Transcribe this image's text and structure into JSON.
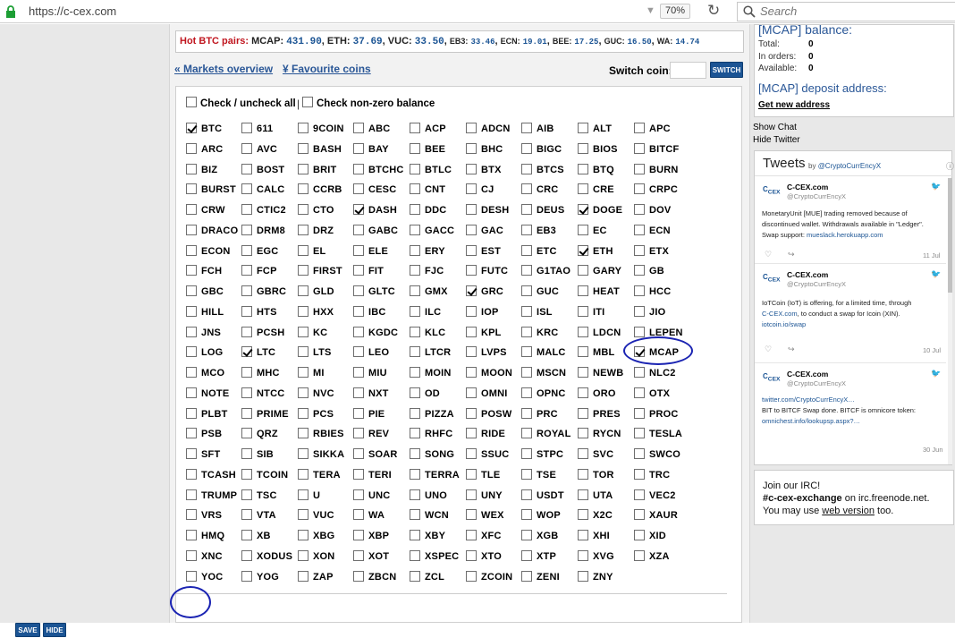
{
  "browser": {
    "url": "https://c-cex.com",
    "zoom": "70%",
    "search_placeholder": "Search"
  },
  "ticker": {
    "label": "Hot BTC pairs:",
    "items": [
      {
        "name": "MCAP",
        "value": "431.90",
        "small": false
      },
      {
        "name": "ETH",
        "value": "37.69",
        "small": false
      },
      {
        "name": "VUC",
        "value": "33.50",
        "small": false
      },
      {
        "name": "EB3",
        "value": "33.46",
        "small": true
      },
      {
        "name": "ECN",
        "value": "19.01",
        "small": true
      },
      {
        "name": "BEE",
        "value": "17.25",
        "small": true
      },
      {
        "name": "GUC",
        "value": "16.50",
        "small": true
      },
      {
        "name": "WA",
        "value": "14.74",
        "small": true
      }
    ]
  },
  "nav": {
    "markets": "Markets overview",
    "favourites": "Favourite coins",
    "switch_label": "Switch coin:",
    "switch_btn": "SWITCH"
  },
  "panel": {
    "check_all": "Check / uncheck all",
    "check_nonzero": "Check non-zero balance",
    "save": "SAVE",
    "hide": "HIDE"
  },
  "coins": [
    "BTC",
    "611",
    "9COIN",
    "ABC",
    "ACP",
    "ADCN",
    "AIB",
    "ALT",
    "APC",
    "ARC",
    "AVC",
    "BASH",
    "BAY",
    "BEE",
    "BHC",
    "BIGC",
    "BIOS",
    "BITCF",
    "BIZ",
    "BOST",
    "BRIT",
    "BTCHC",
    "BTLC",
    "BTX",
    "BTCS",
    "BTQ",
    "BURN",
    "BURST",
    "CALC",
    "CCRB",
    "CESC",
    "CNT",
    "CJ",
    "CRC",
    "CRE",
    "CRPC",
    "CRW",
    "CTIC2",
    "CTO",
    "DASH",
    "DDC",
    "DESH",
    "DEUS",
    "DOGE",
    "DOV",
    "DRACO",
    "DRM8",
    "DRZ",
    "GABC",
    "GACC",
    "GAC",
    "EB3",
    "EC",
    "ECN",
    "ECON",
    "EGC",
    "EL",
    "ELE",
    "ERY",
    "EST",
    "ETC",
    "ETH",
    "ETX",
    "FCH",
    "FCP",
    "FIRST",
    "FIT",
    "FJC",
    "FUTC",
    "G1TAO",
    "GARY",
    "GB",
    "GBC",
    "GBRC",
    "GLD",
    "GLTC",
    "GMX",
    "GRC",
    "GUC",
    "HEAT",
    "HCC",
    "HILL",
    "HTS",
    "HXX",
    "IBC",
    "ILC",
    "IOP",
    "ISL",
    "ITI",
    "JIO",
    "JNS",
    "PCSH",
    "KC",
    "KGDC",
    "KLC",
    "KPL",
    "KRC",
    "LDCN",
    "LEPEN",
    "LOG",
    "LTC",
    "LTS",
    "LEO",
    "LTCR",
    "LVPS",
    "MALC",
    "MBL",
    "MCAP",
    "MCO",
    "MHC",
    "MI",
    "MIU",
    "MOIN",
    "MOON",
    "MSCN",
    "NEWB",
    "NLC2",
    "NOTE",
    "NTCC",
    "NVC",
    "NXT",
    "OD",
    "OMNI",
    "OPNC",
    "ORO",
    "OTX",
    "PLBT",
    "PRIME",
    "PCS",
    "PIE",
    "PIZZA",
    "POSW",
    "PRC",
    "PRES",
    "PROC",
    "PSB",
    "QRZ",
    "RBIES",
    "REV",
    "RHFC",
    "RIDE",
    "ROYAL",
    "RYCN",
    "TESLA",
    "SFT",
    "SIB",
    "SIKKA",
    "SOAR",
    "SONG",
    "SSUC",
    "STPC",
    "SVC",
    "SWCO",
    "TCASH",
    "TCOIN",
    "TERA",
    "TERI",
    "TERRA",
    "TLE",
    "TSE",
    "TOR",
    "TRC",
    "TRUMP",
    "TSC",
    "U",
    "UNC",
    "UNO",
    "UNY",
    "USDT",
    "UTA",
    "VEC2",
    "VRS",
    "VTA",
    "VUC",
    "WA",
    "WCN",
    "WEX",
    "WOP",
    "X2C",
    "XAUR",
    "HMQ",
    "XB",
    "XBG",
    "XBP",
    "XBY",
    "XFC",
    "XGB",
    "XHI",
    "XID",
    "XNC",
    "XODUS",
    "XON",
    "XOT",
    "XSPEC",
    "XTO",
    "XTP",
    "XVG",
    "XZA",
    "YOC",
    "YOG",
    "ZAP",
    "ZBCN",
    "ZCL",
    "ZCOIN",
    "ZENI",
    "ZNY"
  ],
  "checked": [
    "BTC",
    "DASH",
    "DOGE",
    "ETH",
    "GRC",
    "LTC",
    "MCAP"
  ],
  "balance": {
    "title": "[MCAP] balance:",
    "rows": [
      {
        "label": "Total:",
        "value": "0"
      },
      {
        "label": "In orders:",
        "value": "0"
      },
      {
        "label": "Available:",
        "value": "0"
      }
    ],
    "deposit_title": "[MCAP] deposit address:",
    "new_address": "Get new address"
  },
  "side_links": {
    "chat": "Show Chat",
    "twitter": "Hide Twitter"
  },
  "twitter": {
    "title": "Tweets",
    "by": "by",
    "handle_link": "@CryptoCurrEncyX",
    "tweets": [
      {
        "name": "C-CEX.com",
        "handle": "@CryptoCurrEncyX",
        "line1": "MonetaryUnit [MUE] trading removed because of",
        "line2": "discontinued wallet. Withdrawals available in \"Ledger\".",
        "line3": "Swap support: ",
        "link": "mueslack.herokuapp.com",
        "date": "11 Jul"
      },
      {
        "name": "C-CEX.com",
        "handle": "@CryptoCurrEncyX",
        "line1": "IoTCoin (IoT) is offering, for a limited time, through",
        "link1": "C-CEX.com",
        "line2": ", to conduct a swap for Icoin (XIN).",
        "link": "iotcoin.io/swap",
        "date": "10 Jul"
      },
      {
        "name": "C-CEX.com",
        "handle": "@CryptoCurrEncyX",
        "link1": "twitter.com/CryptoCurrEncyX…",
        "line2": "BIT to BITCF Swap done. BITCF is omnicore token:",
        "link": "omnichest.info/lookupsp.aspx?…",
        "date": "30 Jun"
      }
    ]
  },
  "irc": {
    "join": "Join our IRC!",
    "channel": "#c-cex-exchange",
    "on": " on irc.freenode.net.",
    "may": "You may use ",
    "web": "web version",
    "too": " too."
  }
}
